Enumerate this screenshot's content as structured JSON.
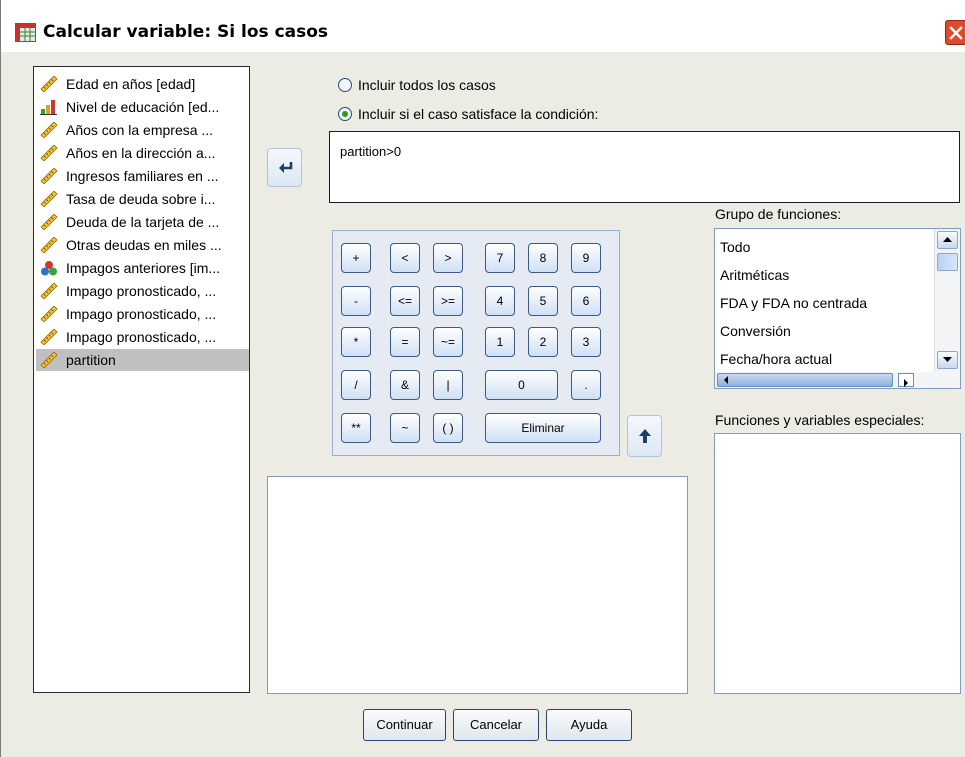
{
  "window": {
    "title": "Calcular variable: Si los casos",
    "icon": "data-grid-icon",
    "close_icon": "close-icon"
  },
  "variables": [
    {
      "label": "Edad en años [edad]",
      "icon": "ruler-icon"
    },
    {
      "label": "Nivel de educación [ed...",
      "icon": "bar-chart-icon"
    },
    {
      "label": "Años con la empresa ...",
      "icon": "ruler-icon"
    },
    {
      "label": "Años en la dirección a...",
      "icon": "ruler-icon"
    },
    {
      "label": "Ingresos familiares en ...",
      "icon": "ruler-icon"
    },
    {
      "label": "Tasa de deuda sobre i...",
      "icon": "ruler-icon"
    },
    {
      "label": "Deuda de la tarjeta de ...",
      "icon": "ruler-icon"
    },
    {
      "label": "Otras deudas en miles ...",
      "icon": "ruler-icon"
    },
    {
      "label": "Impagos anteriores [im...",
      "icon": "nominal-circles-icon"
    },
    {
      "label": "Impago pronosticado, ...",
      "icon": "ruler-icon"
    },
    {
      "label": "Impago pronosticado, ...",
      "icon": "ruler-icon"
    },
    {
      "label": "Impago pronosticado, ...",
      "icon": "ruler-icon"
    },
    {
      "label": "partition",
      "icon": "ruler-icon",
      "selected": true
    }
  ],
  "options": {
    "all_cases": "Incluir todos los casos",
    "if_condition": "Incluir si el caso satisface la condición:",
    "selected": "if_condition"
  },
  "expression": "partition>0",
  "keypad": {
    "rows": [
      [
        "+",
        "<",
        ">",
        "7",
        "8",
        "9"
      ],
      [
        "-",
        "<=",
        ">=",
        "4",
        "5",
        "6"
      ],
      [
        "*",
        "=",
        "~=",
        "1",
        "2",
        "3"
      ],
      [
        "/",
        "&",
        "|",
        "0",
        "."
      ],
      [
        "**",
        "~",
        "( )",
        "Eliminar"
      ]
    ]
  },
  "function_group": {
    "label": "Grupo de funciones:",
    "items": [
      "Todo",
      "Aritméticas",
      "FDA y FDA no centrada",
      "Conversión",
      "Fecha/hora actual"
    ]
  },
  "special_functions": {
    "label": "Funciones y variables especiales:"
  },
  "buttons": {
    "continue": "Continuar",
    "cancel": "Cancelar",
    "help": "Ayuda"
  },
  "colors": {
    "dialog_bg": "#ecebe4",
    "radio_selected": "#21a121",
    "close_button": "#e04a2a"
  }
}
